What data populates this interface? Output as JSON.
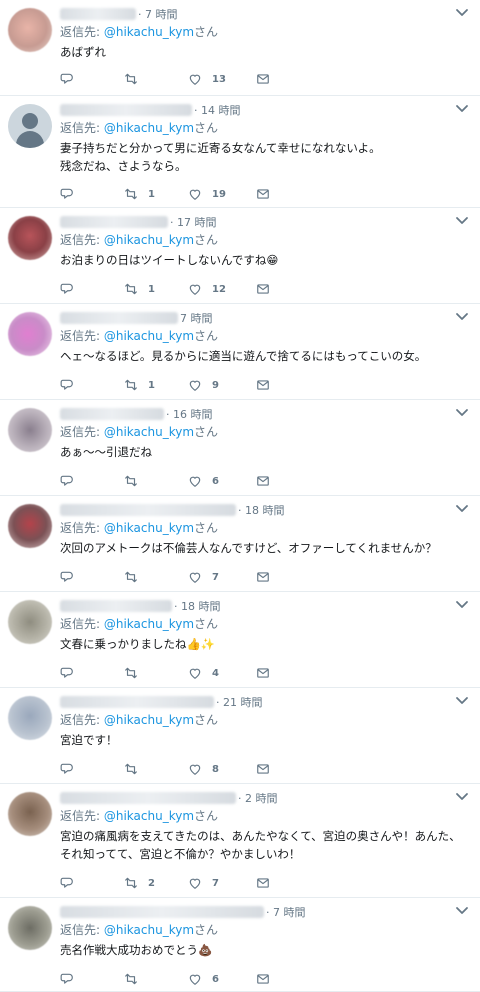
{
  "reply_prefix": "返信先: ",
  "reply_handle": "@hikachu_kym",
  "reply_suffix": "さん",
  "tweets": [
    {
      "time": "· 7 時間",
      "text": "あばずれ",
      "replies": "",
      "retweets": "",
      "likes": "13"
    },
    {
      "time": "· 14 時間",
      "text": "妻子持ちだと分かって男に近寄る女なんて幸せになれないよ。\n残念だね、さようなら。",
      "replies": "",
      "retweets": "1",
      "likes": "19"
    },
    {
      "time": "· 17 時間",
      "text": "お泊まりの日はツイートしないんですね😁",
      "replies": "",
      "retweets": "1",
      "likes": "12"
    },
    {
      "time": "7 時間",
      "text": "ヘェ〜なるほど。見るからに適当に遊んで捨てるにはもってこいの女。",
      "replies": "",
      "retweets": "1",
      "likes": "9"
    },
    {
      "time": "· 16 時間",
      "text": "あぁ〜〜引退だね",
      "replies": "",
      "retweets": "",
      "likes": "6"
    },
    {
      "time": "· 18 時間",
      "text": "次回のアメトークは不倫芸人なんですけど、オファーしてくれませんか？",
      "replies": "",
      "retweets": "",
      "likes": "7"
    },
    {
      "time": "· 18 時間",
      "text": "文春に乗っかりましたね👍✨",
      "replies": "",
      "retweets": "",
      "likes": "4"
    },
    {
      "time": "· 21 時間",
      "text": "宮迫です！",
      "replies": "",
      "retweets": "",
      "likes": "8"
    },
    {
      "time": "· 2 時間",
      "text": "宮迫の痛風病を支えてきたのは、あんたやなくて、宮迫の奥さんや！あんた、それ知ってて、宮迫と不倫か？やかましいわ！",
      "replies": "",
      "retweets": "2",
      "likes": "7"
    },
    {
      "time": "· 7 時間",
      "text": "売名作戦大成功おめでとう💩",
      "replies": "",
      "retweets": "",
      "likes": "6"
    }
  ],
  "icons": {
    "reply": "speech-bubble-icon",
    "retweet": "retweet-arrows-icon",
    "like": "heart-icon",
    "dm": "envelope-icon",
    "menu": "chevron-down-icon"
  },
  "colors": {
    "mention": "#1b95e0",
    "meta": "#657786",
    "text": "#14171a",
    "divider": "#e6ecf0"
  }
}
